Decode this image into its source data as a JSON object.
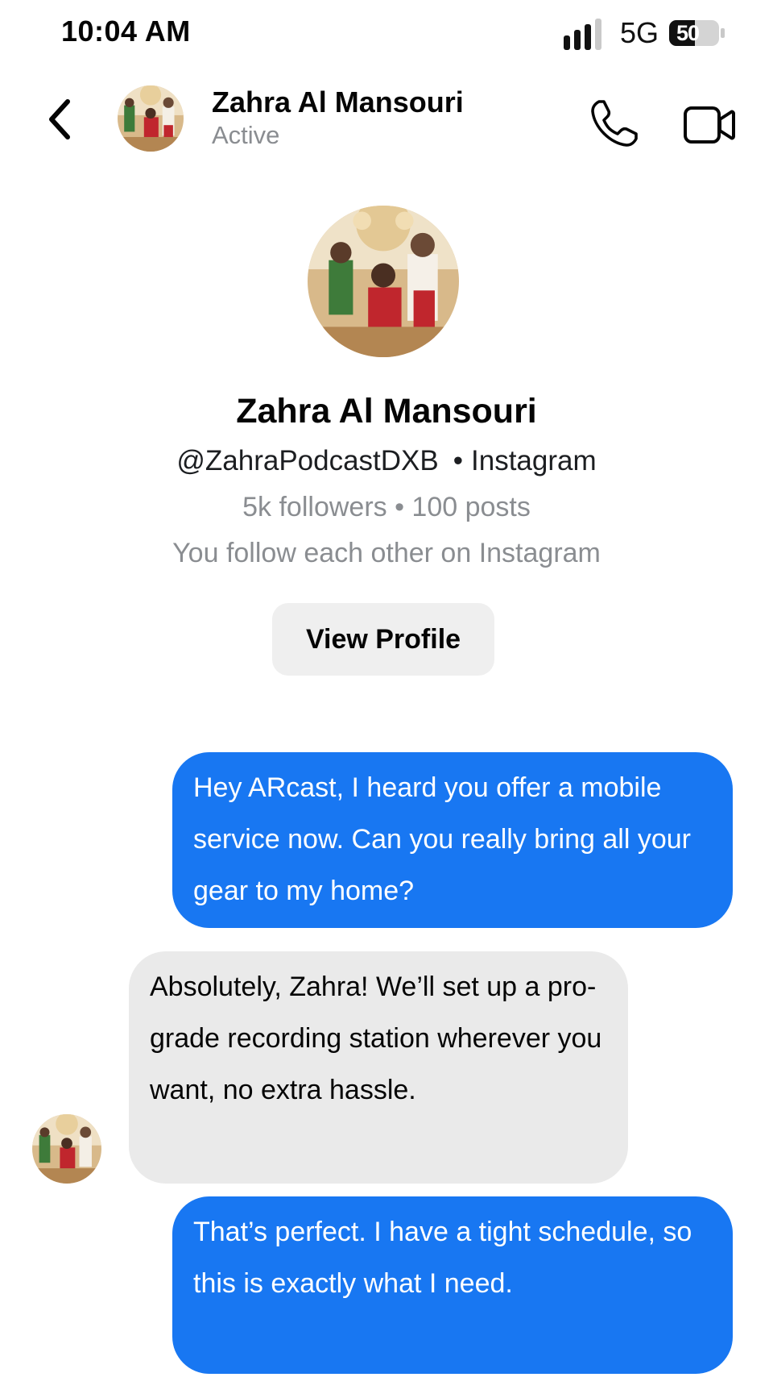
{
  "status_bar": {
    "time": "10:04 AM",
    "network": "5G",
    "battery": "50"
  },
  "header": {
    "contact_name": "Zahra Al Mansouri",
    "presence": "Active",
    "icons": [
      "back-chevron-icon",
      "phone-icon",
      "video-camera-icon"
    ]
  },
  "profile": {
    "name": "Zahra Al Mansouri",
    "handle": "@ZahraPodcastDXB",
    "platform": "Instagram",
    "stats": "5k followers • 100 posts",
    "mutual": "You follow each other on Instagram",
    "view_profile_label": "View Profile"
  },
  "messages": [
    {
      "sender": "me",
      "text": "Hey ARcast, I heard you offer a mobile service now. Can you really bring all your gear to my home?"
    },
    {
      "sender": "Zahra Al Mansouri",
      "text": "Absolutely, Zahra! We’ll set up a pro-grade recording station wherever you want, no extra hassle."
    },
    {
      "sender": "me",
      "text": "That’s perfect. I have a tight schedule, so this is exactly what I need."
    }
  ],
  "colors": {
    "sent_bubble": "#1877f2",
    "received_bubble": "#eaeaea",
    "secondary_text": "#8a8d91",
    "button_bg": "#efefef"
  }
}
